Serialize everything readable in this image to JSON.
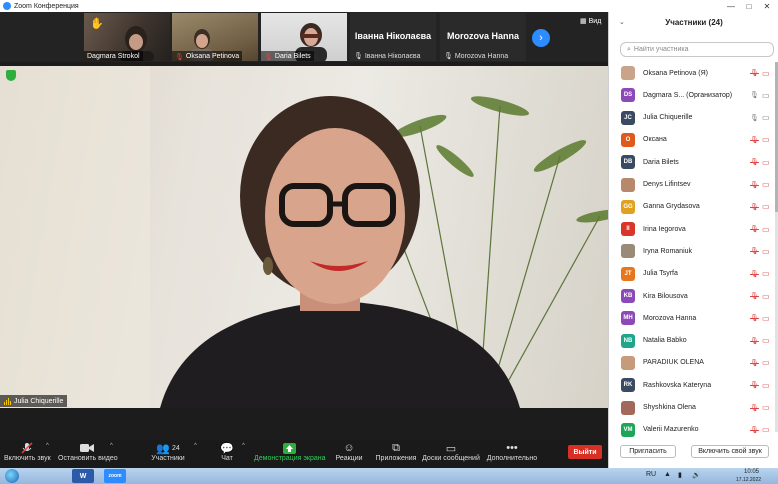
{
  "window": {
    "title": "Zoom Конференция",
    "controls": [
      "—",
      "□",
      "✕"
    ]
  },
  "thumbnails": [
    {
      "name": "Dagmara Strokol",
      "raised_hand": "✋",
      "muted": false
    },
    {
      "name": "Oksana Petinova",
      "muted": true
    },
    {
      "name": "Daria Bilets",
      "muted": true
    }
  ],
  "name_tiles": [
    {
      "big": "Івaнна Ніколаєва",
      "small": "Іванна Ніколаєва"
    },
    {
      "big": "Morozova Hanna",
      "small": "Morozova Hanna"
    }
  ],
  "view_button": {
    "label": "Вид",
    "icon": "grid-icon"
  },
  "main_video": {
    "speaker": "Julia Chiquerille"
  },
  "toolbar": {
    "audio": "Включить звук",
    "video": "Остановить видео",
    "participants": "Участники",
    "participants_count": "24",
    "chat": "Чат",
    "share": "Демонстрация экрана",
    "reactions": "Реакции",
    "apps": "Приложения",
    "whiteboards": "Доски сообщений",
    "more": "Дополнительно",
    "leave": "Выйти"
  },
  "panel": {
    "title": "Участники (24)",
    "search_placeholder": "Найти участника",
    "participants": [
      {
        "name": "Oksana Petinova (Я)",
        "initials": "",
        "color": "#c9a48a",
        "mic": "muted",
        "video": "muted"
      },
      {
        "name": "Dagmara S...  (Организатор)",
        "initials": "DS",
        "color": "#8b4ab8",
        "mic": "on",
        "video": "off",
        "hand": "✋"
      },
      {
        "name": "Julia Chiquerille",
        "initials": "JC",
        "color": "#3a4a63",
        "mic": "on",
        "video": "on"
      },
      {
        "name": "Оксана",
        "initials": "О",
        "color": "#e05a1e",
        "mic": "muted",
        "video": "muted"
      },
      {
        "name": "Daria Bilets",
        "initials": "DB",
        "color": "#3a4a63",
        "mic": "muted",
        "video": "muted"
      },
      {
        "name": "Denys Lifintsev",
        "initials": "",
        "color": "#b7886a",
        "mic": "muted",
        "video": "muted"
      },
      {
        "name": "Ganna Grydasova",
        "initials": "GG",
        "color": "#e0a21e",
        "mic": "muted",
        "video": "muted"
      },
      {
        "name": "Irina Iegorova",
        "initials": "II",
        "color": "#d9362b",
        "mic": "muted",
        "video": "muted"
      },
      {
        "name": "Iryna Romaniuk",
        "initials": "",
        "color": "#9a8a78",
        "mic": "muted",
        "video": "muted"
      },
      {
        "name": "Julia Tsyrfa",
        "initials": "JT",
        "color": "#e8761e",
        "mic": "muted",
        "video": "muted"
      },
      {
        "name": "Kira Bilousova",
        "initials": "KB",
        "color": "#8b4ab8",
        "mic": "muted",
        "video": "muted"
      },
      {
        "name": "Morozova Hanna",
        "initials": "MH",
        "color": "#8b4ab8",
        "mic": "muted",
        "video": "muted"
      },
      {
        "name": "Natalia Babko",
        "initials": "NB",
        "color": "#1fa58a",
        "mic": "muted",
        "video": "muted"
      },
      {
        "name": "PARADIUK OLENA",
        "initials": "",
        "color": "#c79a7a",
        "mic": "muted",
        "video": "muted"
      },
      {
        "name": "Rashkovska Kateryna",
        "initials": "RK",
        "color": "#3a4a63",
        "mic": "muted",
        "video": "muted"
      },
      {
        "name": "Shyshkina Olena",
        "initials": "",
        "color": "#a2685a",
        "mic": "muted",
        "video": "muted"
      },
      {
        "name": "Valerii Mazurenko",
        "initials": "VM",
        "color": "#1fa55a",
        "mic": "muted",
        "video": "muted"
      }
    ],
    "invite": "Пригласить",
    "unmute": "Включить свой звук"
  },
  "taskbar": {
    "lang": "RU",
    "time": "10:05",
    "date": "17.12.2022",
    "apps": [
      {
        "label": "W",
        "color": "#2b5aa8"
      },
      {
        "label": "zoom",
        "color": "#2d8cff"
      }
    ]
  }
}
